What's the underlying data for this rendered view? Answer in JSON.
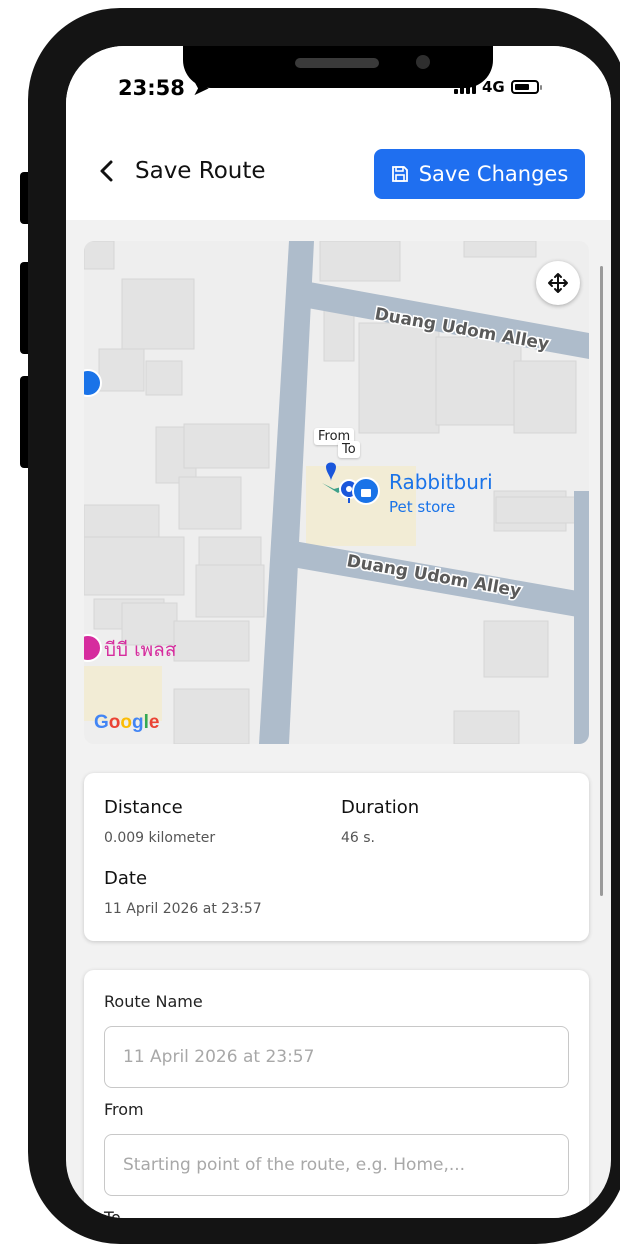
{
  "status_bar": {
    "time": "23:58",
    "network": "4G"
  },
  "header": {
    "title": "Save Route",
    "save_label": "Save Changes"
  },
  "map": {
    "streets": [
      "Duang Udom Alley",
      "Duang Udom Alley"
    ],
    "place_name": "Rabbitburi",
    "place_category": "Pet store",
    "pin_from": "From",
    "pin_to": "To",
    "poi_thai": "บีบี เพลส",
    "provider": "Google"
  },
  "info": {
    "distance_label": "Distance",
    "distance_value": "0.009 kilometer",
    "duration_label": "Duration",
    "duration_value": "46 s.",
    "date_label": "Date",
    "date_value": "11 April 2026 at 23:57"
  },
  "form": {
    "route_name_label": "Route Name",
    "route_name_placeholder": "11 April 2026 at 23:57",
    "from_label": "From",
    "from_placeholder": "Starting point of the route, e.g. Home,...",
    "to_label": "To"
  },
  "colors": {
    "accent": "#1f6ff0",
    "poi_pink": "#d62c9e",
    "place_blue": "#1a73e8"
  }
}
